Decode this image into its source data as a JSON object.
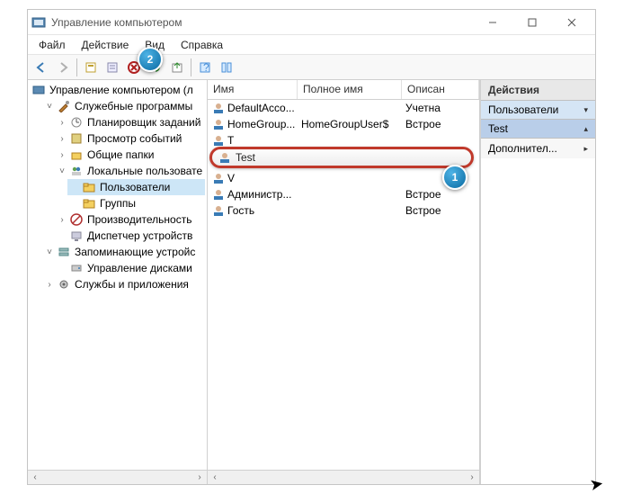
{
  "window": {
    "title": "Управление компьютером"
  },
  "menu": {
    "file": "Файл",
    "action": "Действие",
    "view": "Вид",
    "help": "Справка"
  },
  "tree": {
    "root": "Управление компьютером (л",
    "sys_tools": "Служебные программы",
    "scheduler": "Планировщик заданий",
    "events": "Просмотр событий",
    "shared": "Общие папки",
    "lusers": "Локальные пользовате",
    "users": "Пользователи",
    "groups": "Группы",
    "perf": "Производительность",
    "devmgr": "Диспетчер устройств",
    "storage": "Запоминающие устройс",
    "diskmgr": "Управление дисками",
    "services": "Службы и приложения"
  },
  "list": {
    "col_name": "Имя",
    "col_full": "Полное имя",
    "col_desc": "Описан",
    "rows": [
      {
        "name": "DefaultAcco...",
        "full": "",
        "desc": "Учетна"
      },
      {
        "name": "HomeGroup...",
        "full": "HomeGroupUser$",
        "desc": "Встрое"
      },
      {
        "name": "T",
        "full": "",
        "desc": ""
      },
      {
        "name": "Test",
        "full": "",
        "desc": ""
      },
      {
        "name": "V",
        "full": "",
        "desc": ""
      },
      {
        "name": "Администр...",
        "full": "",
        "desc": "Встрое"
      },
      {
        "name": "Гость",
        "full": "",
        "desc": "Встрое"
      }
    ],
    "selected_label": "Test"
  },
  "actions": {
    "title": "Действия",
    "group": "Пользователи",
    "context": "Test",
    "more": "Дополнител..."
  },
  "badges": {
    "b1": "1",
    "b2": "2"
  }
}
